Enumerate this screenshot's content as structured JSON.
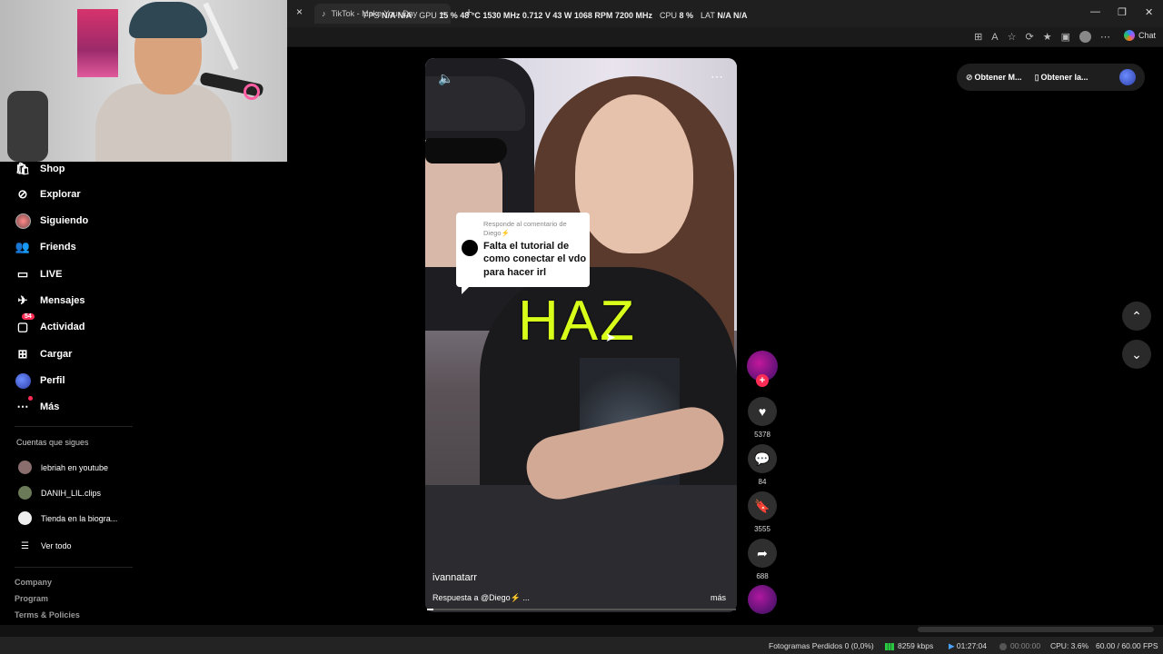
{
  "browser": {
    "tab_title": "TikTok - Make Your Day",
    "tab_close_glyph": "×",
    "new_tab_glyph": "+",
    "window_controls": [
      "—",
      "❐",
      "✕"
    ],
    "chat_label": "Chat"
  },
  "overlay_stats": {
    "fps_label": "FPS",
    "fps_values": "N/A  N/A",
    "gpu_label": "GPU",
    "gpu_values": "15 %  48 °C  1530 MHz  0.712 V  43 W  1068 RPM  7200 MHz",
    "cpu_label": "CPU",
    "cpu_value": "8 %",
    "lat_label": "LAT",
    "lat_values": "N/A  N/A"
  },
  "sidebar": {
    "items": [
      {
        "label": "Shop",
        "icon": "shop-icon"
      },
      {
        "label": "Explorar",
        "icon": "compass-icon"
      },
      {
        "label": "Siguiendo",
        "icon": "following-avatar"
      },
      {
        "label": "Friends",
        "icon": "friends-icon"
      },
      {
        "label": "LIVE",
        "icon": "live-icon"
      },
      {
        "label": "Mensajes",
        "icon": "messages-icon"
      },
      {
        "label": "Actividad",
        "icon": "activity-icon",
        "badge": "54"
      },
      {
        "label": "Cargar",
        "icon": "upload-icon"
      },
      {
        "label": "Perfil",
        "icon": "profile-avatar"
      },
      {
        "label": "Más",
        "icon": "more-icon"
      }
    ],
    "following_title": "Cuentas que sigues",
    "following": [
      {
        "name": "lebriah en youtube"
      },
      {
        "name": "DANIH_LIL.clips"
      },
      {
        "name": "Tienda en la biogra..."
      }
    ],
    "see_all": "Ver todo",
    "footer_links": [
      "Company",
      "Program",
      "Terms & Policies"
    ]
  },
  "video": {
    "reply_header": "Responde al comentario de Diego⚡",
    "reply_text": "Falta el tutorial de como conectar el vdo para hacer irl",
    "caption_big": "HAZ",
    "author": "ivannatarr",
    "description": "Respuesta a @Diego⚡ ...",
    "more_label": "más",
    "progress": 0.02
  },
  "actions": {
    "likes": "5378",
    "comments": "84",
    "saves": "3555",
    "shares": "688"
  },
  "get_app": {
    "desktop_label": "Obtener M...",
    "mobile_label": "Obtener la..."
  },
  "statusbar": {
    "dropped_frames": "Fotogramas Perdidos 0 (0,0%)",
    "bitrate": "8259 kbps",
    "stream_time": "01:27:04",
    "rec_time": "00:00:00",
    "cpu": "CPU: 3.6%",
    "fps": "60.00 / 60.00 FPS"
  },
  "colors": {
    "accent": "#fe2c55",
    "caption": "#d7ff1a",
    "background": "#000000"
  }
}
